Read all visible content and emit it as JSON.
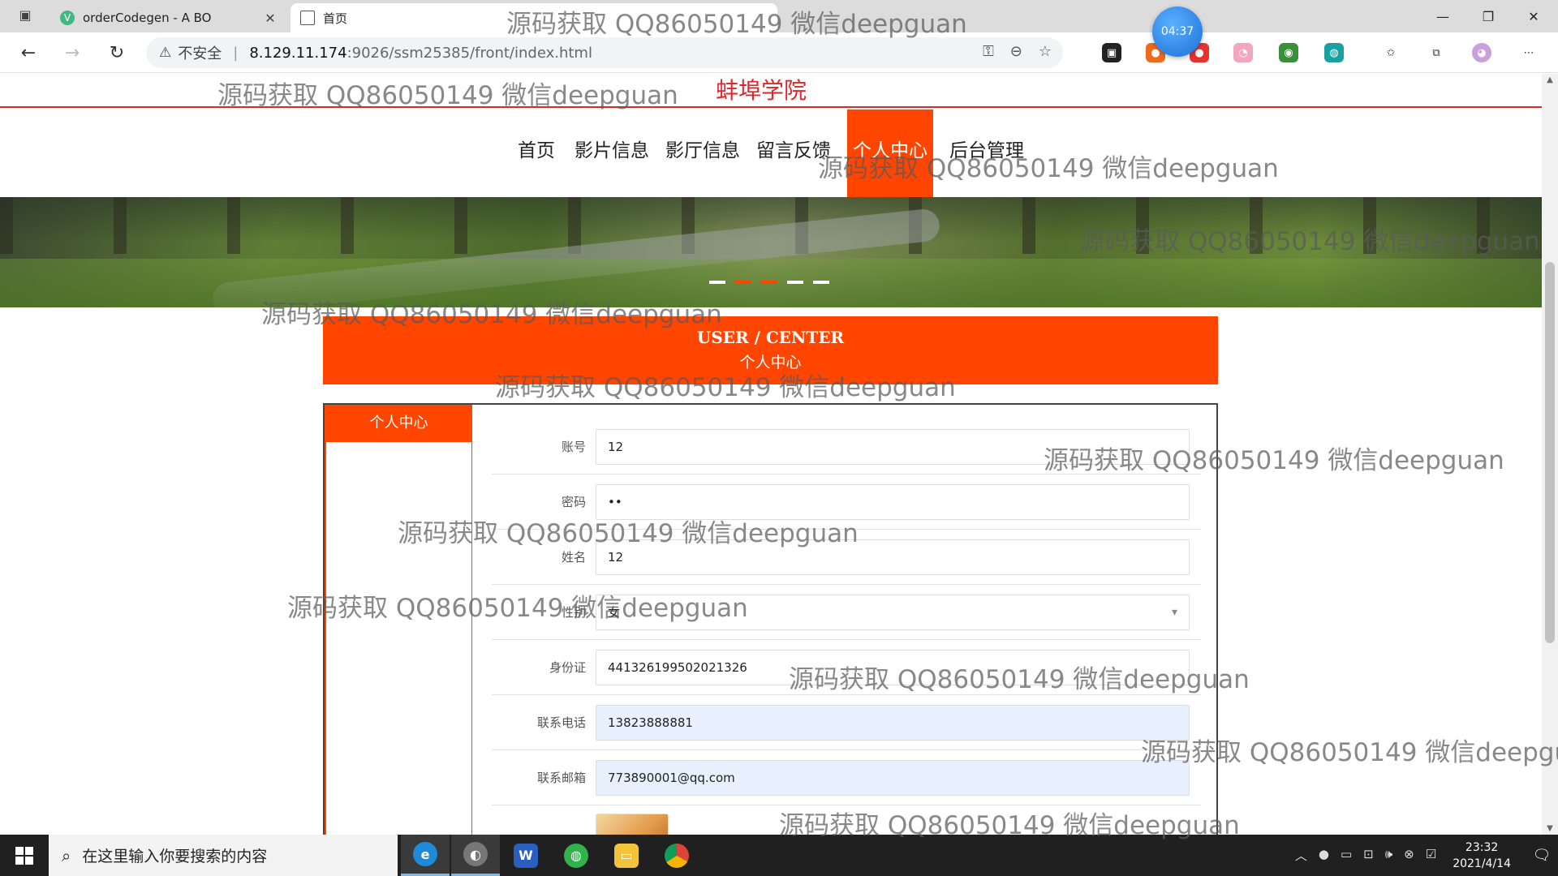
{
  "browser": {
    "tabs": [
      {
        "title": "orderCodegen - A BO",
        "active": false
      },
      {
        "title": "首页",
        "active": true
      }
    ],
    "url_host": "8.129.11.174",
    "url_path": ":9026/ssm25385/front/index.html",
    "security_label": "不安全",
    "timer": "04:37"
  },
  "site": {
    "title": "蚌埠学院",
    "nav": [
      "首页",
      "影片信息",
      "影厅信息",
      "留言反馈",
      "个人中心",
      "后台管理"
    ],
    "active_nav": "个人中心"
  },
  "user_center": {
    "heading_en": "USER / CENTER",
    "heading_cn": "个人中心",
    "sidebar_title": "个人中心",
    "fields": [
      {
        "label": "账号",
        "value": "12"
      },
      {
        "label": "密码",
        "value": "••"
      },
      {
        "label": "姓名",
        "value": "12"
      },
      {
        "label": "性别",
        "value": "女"
      },
      {
        "label": "身份证",
        "value": "441326199502021326"
      },
      {
        "label": "联系电话",
        "value": "13823888881"
      },
      {
        "label": "联系邮箱",
        "value": "773890001@qq.com"
      }
    ]
  },
  "watermark": "源码获取 QQ86050149 微信deepguan",
  "taskbar": {
    "search_placeholder": "在这里输入你要搜索的内容",
    "time": "23:32",
    "date": "2021/4/14"
  },
  "colors": {
    "accent": "#ff4500",
    "title_red": "#e0262a"
  }
}
